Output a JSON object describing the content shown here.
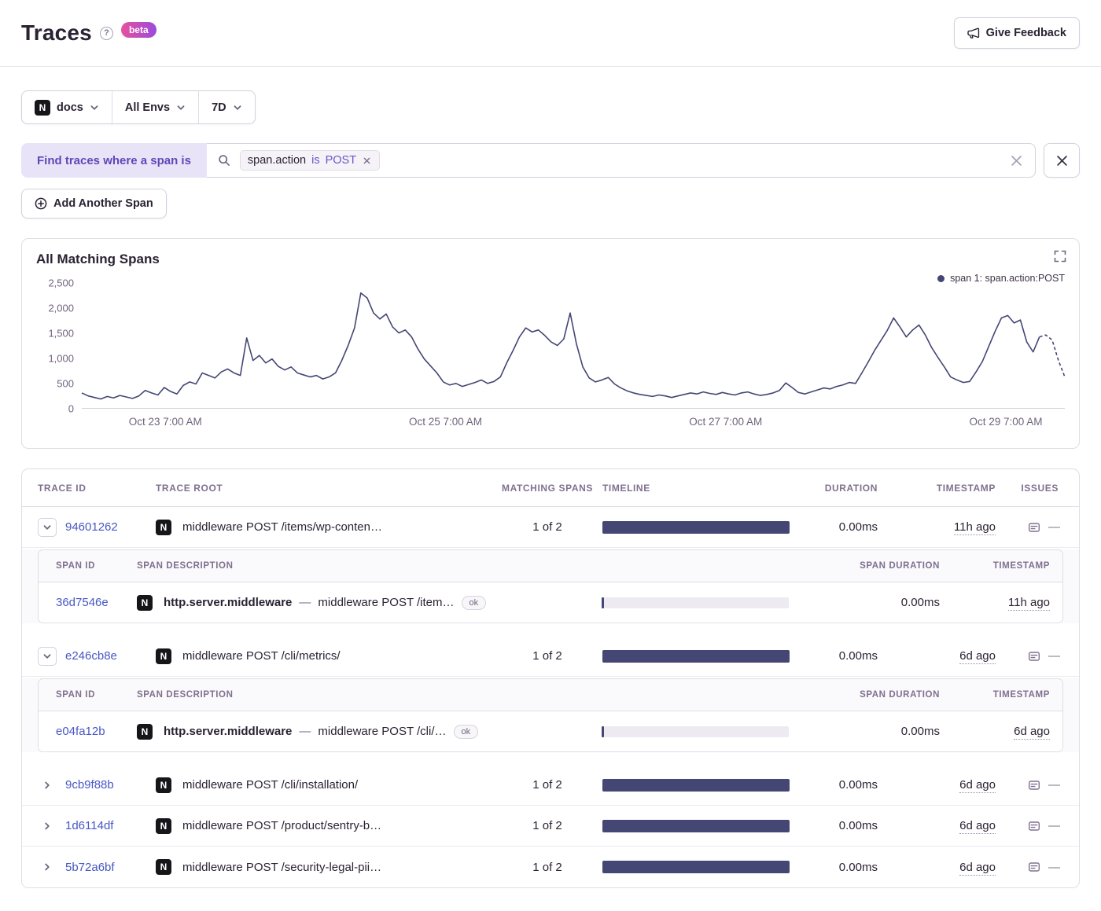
{
  "colors": {
    "accent_purple": "#6559c5",
    "link_blue": "#4757c4",
    "chart_navy": "#444674",
    "beta_gradient": [
      "#e8509f",
      "#9a4bdc"
    ]
  },
  "icons": {
    "project_letter": "N"
  },
  "header": {
    "title": "Traces",
    "help_glyph": "?",
    "beta_label": "beta",
    "feedback_button": "Give Feedback"
  },
  "filter_bar": {
    "project": "docs",
    "environment": "All Envs",
    "date_range": "7D"
  },
  "span_search": {
    "prefix_label": "Find traces where a span is",
    "token": {
      "key": "span.action",
      "operator": "is",
      "value": "POST"
    },
    "add_button": "Add Another Span"
  },
  "chart": {
    "title": "All Matching Spans",
    "legend": "span 1: span.action:POST",
    "chart_data": {
      "type": "line",
      "title": "All Matching Spans",
      "series_name": "span 1: span.action:POST",
      "color": "#444674",
      "ylim": [
        0,
        2500
      ],
      "y_ticks": [
        "2,500",
        "2,000",
        "1,500",
        "1,000",
        "500",
        "0"
      ],
      "x_ticks": [
        {
          "label": "Oct 23 7:00 AM",
          "pos": 8.5
        },
        {
          "label": "Oct 25 7:00 AM",
          "pos": 37.0
        },
        {
          "label": "Oct 27 7:00 AM",
          "pos": 65.5
        },
        {
          "label": "Oct 29 7:00 AM",
          "pos": 94.0
        }
      ],
      "grid": false,
      "legend_position": "top-right",
      "dashed_tail_points": 5,
      "values": [
        300,
        240,
        210,
        180,
        230,
        200,
        250,
        220,
        190,
        240,
        350,
        300,
        260,
        410,
        330,
        280,
        450,
        520,
        480,
        700,
        650,
        600,
        720,
        780,
        700,
        650,
        1400,
        950,
        1050,
        900,
        980,
        830,
        760,
        820,
        700,
        660,
        620,
        650,
        580,
        620,
        700,
        950,
        1250,
        1600,
        2300,
        2200,
        1900,
        1780,
        1880,
        1620,
        1500,
        1560,
        1420,
        1180,
        980,
        840,
        700,
        520,
        460,
        490,
        430,
        470,
        510,
        560,
        490,
        530,
        620,
        900,
        1150,
        1420,
        1600,
        1520,
        1560,
        1450,
        1320,
        1250,
        1380,
        1900,
        1280,
        820,
        600,
        520,
        560,
        610,
        480,
        400,
        340,
        300,
        270,
        250,
        230,
        260,
        240,
        210,
        240,
        270,
        300,
        280,
        320,
        290,
        270,
        310,
        280,
        260,
        300,
        320,
        280,
        250,
        270,
        300,
        350,
        500,
        410,
        310,
        280,
        320,
        360,
        400,
        380,
        430,
        460,
        510,
        490,
        700,
        920,
        1150,
        1350,
        1550,
        1800,
        1620,
        1420,
        1560,
        1660,
        1460,
        1210,
        1010,
        820,
        620,
        560,
        510,
        530,
        720,
        930,
        1230,
        1530,
        1800,
        1850,
        1700,
        1760,
        1320,
        1120,
        1420,
        1460,
        1360,
        950,
        620
      ]
    }
  },
  "table": {
    "headers": [
      "TRACE ID",
      "TRACE ROOT",
      "MATCHING SPANS",
      "TIMELINE",
      "DURATION",
      "TIMESTAMP",
      "ISSUES"
    ],
    "sub_headers": [
      "SPAN ID",
      "SPAN DESCRIPTION",
      "SPAN DURATION",
      "TIMESTAMP"
    ],
    "desc_separator": "—",
    "issues_empty": "—",
    "rows": [
      {
        "trace_id": "94601262",
        "trace_root": "middleware POST /items/wp-conten…",
        "matching_spans": "1 of 2",
        "duration": "0.00ms",
        "timestamp": "11h ago",
        "expanded": true,
        "spans": [
          {
            "span_id": "36d7546e",
            "operation": "http.server.middleware",
            "description": "middleware POST /item…",
            "status": "ok",
            "duration": "0.00ms",
            "timestamp": "11h ago"
          }
        ]
      },
      {
        "trace_id": "e246cb8e",
        "trace_root": "middleware POST /cli/metrics/",
        "matching_spans": "1 of 2",
        "duration": "0.00ms",
        "timestamp": "6d ago",
        "expanded": true,
        "spans": [
          {
            "span_id": "e04fa12b",
            "operation": "http.server.middleware",
            "description": "middleware POST /cli/…",
            "status": "ok",
            "duration": "0.00ms",
            "timestamp": "6d ago"
          }
        ]
      },
      {
        "trace_id": "9cb9f88b",
        "trace_root": "middleware POST /cli/installation/",
        "matching_spans": "1 of 2",
        "duration": "0.00ms",
        "timestamp": "6d ago",
        "expanded": false,
        "spans": []
      },
      {
        "trace_id": "1d6114df",
        "trace_root": "middleware POST /product/sentry-b…",
        "matching_spans": "1 of 2",
        "duration": "0.00ms",
        "timestamp": "6d ago",
        "expanded": false,
        "spans": []
      },
      {
        "trace_id": "5b72a6bf",
        "trace_root": "middleware POST /security-legal-pii…",
        "matching_spans": "1 of 2",
        "duration": "0.00ms",
        "timestamp": "6d ago",
        "expanded": false,
        "spans": []
      }
    ]
  }
}
